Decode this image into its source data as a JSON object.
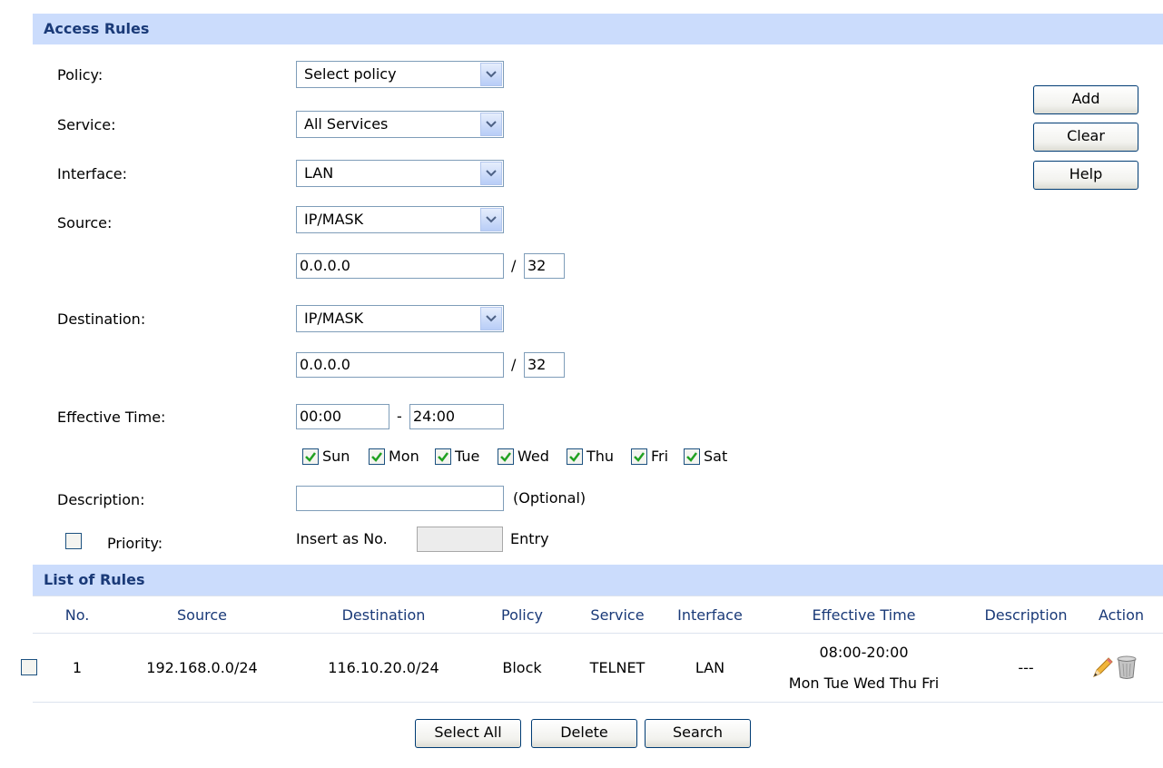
{
  "access_rules": {
    "title": "Access Rules",
    "policy": {
      "label": "Policy:",
      "value": "Select policy"
    },
    "service": {
      "label": "Service:",
      "value": "All Services"
    },
    "interface": {
      "label": "Interface:",
      "value": "LAN"
    },
    "source": {
      "label": "Source:",
      "type": "IP/MASK",
      "ip": "0.0.0.0",
      "slash": "/",
      "mask": "32"
    },
    "destination": {
      "label": "Destination:",
      "type": "IP/MASK",
      "ip": "0.0.0.0",
      "slash": "/",
      "mask": "32"
    },
    "effective_time": {
      "label": "Effective Time:",
      "start": "00:00",
      "dash": "-",
      "end": "24:00"
    },
    "days": [
      {
        "label": "Sun",
        "checked": true
      },
      {
        "label": "Mon",
        "checked": true
      },
      {
        "label": "Tue",
        "checked": true
      },
      {
        "label": "Wed",
        "checked": true
      },
      {
        "label": "Thu",
        "checked": true
      },
      {
        "label": "Fri",
        "checked": true
      },
      {
        "label": "Sat",
        "checked": true
      }
    ],
    "description": {
      "label": "Description:",
      "value": "",
      "hint": "(Optional)"
    },
    "priority": {
      "label": "Priority:",
      "checked": false,
      "insert_label": "Insert as No.",
      "value": "",
      "entry_label": "Entry"
    },
    "buttons": {
      "add": "Add",
      "clear": "Clear",
      "help": "Help"
    }
  },
  "list_of_rules": {
    "title": "List of Rules",
    "columns": [
      "No.",
      "Source",
      "Destination",
      "Policy",
      "Service",
      "Interface",
      "Effective Time",
      "Description",
      "Action"
    ],
    "rows": [
      {
        "no": "1",
        "source": "192.168.0.0/24",
        "destination": "116.10.20.0/24",
        "policy": "Block",
        "service": "TELNET",
        "interface": "LAN",
        "time": "08:00-20:00",
        "days": "Mon Tue Wed Thu Fri",
        "description": "---",
        "checked": false
      }
    ],
    "buttons": {
      "select_all": "Select All",
      "delete": "Delete",
      "search": "Search"
    }
  },
  "colors": {
    "header_bg": "#cbdcfc",
    "header_text": "#1a3a78",
    "check_green": "#21a121"
  },
  "icons": {
    "dropdown": "chevron-down-icon",
    "edit": "pencil-icon",
    "delete": "trash-icon"
  }
}
